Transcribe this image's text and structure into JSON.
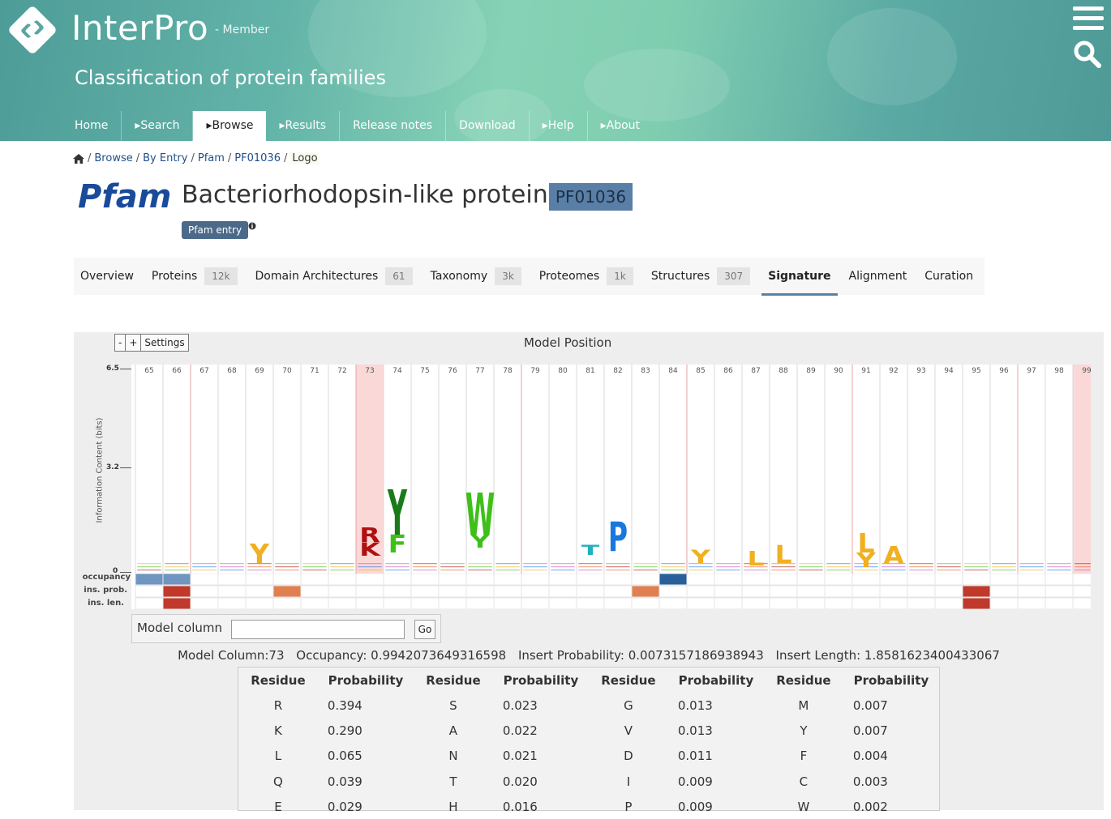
{
  "header": {
    "brand": "InterPro",
    "member_label": "- Member",
    "tagline": "Classification of protein families",
    "menu_icon": "hamburger-icon",
    "search_icon": "search-icon"
  },
  "nav": {
    "items": [
      {
        "label": "Home"
      },
      {
        "label": "▸Search"
      },
      {
        "label": "▸Browse"
      },
      {
        "label": "▸Results"
      },
      {
        "label": "Release notes"
      },
      {
        "label": "Download"
      },
      {
        "label": "▸Help"
      },
      {
        "label": "▸About"
      }
    ],
    "active": "▸Browse"
  },
  "breadcrumb": {
    "home_icon": "home-icon",
    "items": [
      "Browse",
      "By Entry",
      "Pfam",
      "PF01036",
      "Logo"
    ],
    "separator": "/"
  },
  "entry": {
    "db_logo": "Pfam",
    "title": "Bacteriorhodopsin-like protein",
    "accession": "PF01036",
    "type_badge": "Pfam entry",
    "info_icon": "info-icon"
  },
  "tabs": [
    {
      "label": "Overview",
      "count": ""
    },
    {
      "label": "Proteins",
      "count": "12k"
    },
    {
      "label": "Domain Architectures",
      "count": "61"
    },
    {
      "label": "Taxonomy",
      "count": "3k"
    },
    {
      "label": "Proteomes",
      "count": "1k"
    },
    {
      "label": "Structures",
      "count": "307"
    },
    {
      "label": "Signature",
      "count": "",
      "active": true
    },
    {
      "label": "Alignment",
      "count": ""
    },
    {
      "label": "Curation",
      "count": ""
    }
  ],
  "logo_panel": {
    "zoom_out": "-",
    "zoom_in": "+",
    "settings": "Settings",
    "model_position_label": "Model Position",
    "y_axis_label": "Information Content (bits)",
    "y_ticks": [
      "6.5",
      "3.2",
      "0"
    ],
    "row_labels": [
      "occupancy",
      "ins. prob.",
      "ins. len."
    ],
    "columns": [
      "65",
      "66",
      "67",
      "68",
      "69",
      "70",
      "71",
      "72",
      "73",
      "74",
      "75",
      "76",
      "77",
      "78",
      "79",
      "80",
      "81",
      "82",
      "83",
      "84",
      "85",
      "86",
      "87",
      "88",
      "89",
      "90",
      "91",
      "92",
      "93",
      "94",
      "95",
      "96",
      "97",
      "98",
      "99"
    ],
    "highlighted_columns": [
      "73",
      "99"
    ],
    "model_column_label": "Model column",
    "model_column_value": "",
    "go_button": "Go"
  },
  "summary": {
    "model_column": "Model Column:73",
    "occupancy": "Occupancy: 0.9942073649316598",
    "insert_probability": "Insert Probability: 0.0073157186938943",
    "insert_length": "Insert Length: 1.8581623400433067"
  },
  "probability_table": {
    "headers": [
      "Residue",
      "Probability",
      "Residue",
      "Probability",
      "Residue",
      "Probability",
      "Residue",
      "Probability"
    ],
    "rows": [
      [
        "R",
        "0.394",
        "S",
        "0.023",
        "G",
        "0.013",
        "M",
        "0.007"
      ],
      [
        "K",
        "0.290",
        "A",
        "0.022",
        "V",
        "0.013",
        "Y",
        "0.007"
      ],
      [
        "L",
        "0.065",
        "N",
        "0.021",
        "D",
        "0.011",
        "F",
        "0.004"
      ],
      [
        "Q",
        "0.039",
        "T",
        "0.020",
        "I",
        "0.009",
        "C",
        "0.003"
      ],
      [
        "E",
        "0.029",
        "H",
        "0.016",
        "P",
        "0.009",
        "W",
        "0.002"
      ]
    ]
  },
  "colors": {
    "header_teal": "#5aaaa3",
    "accent_blue": "#5a7fa7",
    "highlight_column": "#fbd8d8",
    "hydrophobic_green": "#3fbf1a",
    "aromatic_yellow": "#f0b020",
    "positive_red": "#b01010",
    "proline": "#1878e0"
  }
}
